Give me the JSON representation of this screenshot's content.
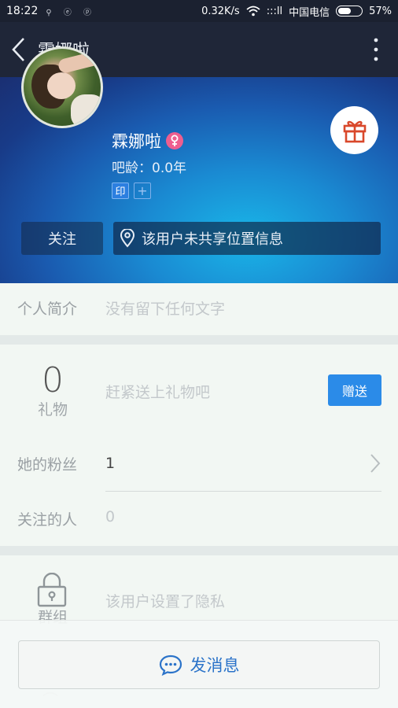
{
  "status_bar": {
    "time": "18:22",
    "notifications": "⚲ ⓔ ⓟ",
    "speed": "0.32K/s",
    "signal": ":::ll",
    "carrier": "中国电信",
    "battery": "57%",
    "battery_level": 0.57
  },
  "header": {
    "title": "霖娜啦",
    "back_icon": "chevron-left-icon",
    "more_icon": "more-vertical-icon"
  },
  "profile": {
    "name": "霖娜啦",
    "gender_symbol": "♀",
    "bar_age_label": "吧龄：",
    "bar_age_value": "0.0年",
    "seal_badge": "印",
    "add_badge": "+",
    "follow_label": "关注",
    "location_text": "该用户未共享位置信息",
    "gender_color": "#ee5e8f"
  },
  "intro": {
    "label": "个人简介",
    "value": "没有留下任何文字"
  },
  "gifts": {
    "count": "0",
    "label": "礼物",
    "hint": "赶紧送上礼物吧",
    "give_label": "赠送"
  },
  "fans": {
    "label": "她的粉丝",
    "value": "1"
  },
  "following": {
    "label": "关注的人",
    "value": "0"
  },
  "group": {
    "label": "群组",
    "privacy_text": "该用户设置了隐私",
    "partial_text": "⌒"
  },
  "bottom": {
    "message_label": "发消息"
  },
  "colors": {
    "accent": "#2b8be8",
    "header_bg": "#1f2638",
    "gift_icon": "#d9482b"
  }
}
